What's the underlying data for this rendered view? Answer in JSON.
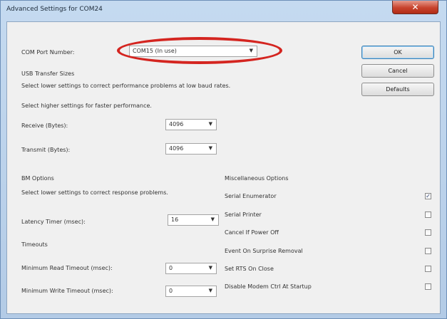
{
  "window": {
    "title": "Advanced Settings for COM24",
    "close_glyph": "✕"
  },
  "com_port": {
    "label": "COM Port Number:",
    "value": "COM15 (In use)"
  },
  "usb_transfer": {
    "heading": "USB Transfer Sizes",
    "hint_lower": "Select lower settings to correct performance problems at low baud rates.",
    "hint_higher": "Select higher settings for faster performance.",
    "receive": {
      "label": "Receive (Bytes):",
      "value": "4096"
    },
    "transmit": {
      "label": "Transmit (Bytes):",
      "value": "4096"
    }
  },
  "bm_options": {
    "heading": "BM Options",
    "hint": "Select lower settings to correct response problems.",
    "latency": {
      "label": "Latency Timer (msec):",
      "value": "16"
    }
  },
  "timeouts": {
    "heading": "Timeouts",
    "read": {
      "label": "Minimum Read Timeout (msec):",
      "value": "0"
    },
    "write": {
      "label": "Minimum Write Timeout (msec):",
      "value": "0"
    }
  },
  "misc": {
    "heading": "Miscellaneous Options",
    "items": [
      {
        "label": "Serial Enumerator",
        "checked": true
      },
      {
        "label": "Serial Printer",
        "checked": false
      },
      {
        "label": "Cancel If Power Off",
        "checked": false
      },
      {
        "label": "Event On Surprise Removal",
        "checked": false
      },
      {
        "label": "Set RTS On Close",
        "checked": false
      },
      {
        "label": "Disable Modem Ctrl At Startup",
        "checked": false
      }
    ]
  },
  "buttons": {
    "ok": "OK",
    "cancel": "Cancel",
    "defaults": "Defaults"
  },
  "icons": {
    "dropdown": "chevron-down-icon",
    "check": "checkmark-icon"
  },
  "colors": {
    "highlight_ellipse": "#d42520",
    "title_bar": "#b8cfe8"
  }
}
